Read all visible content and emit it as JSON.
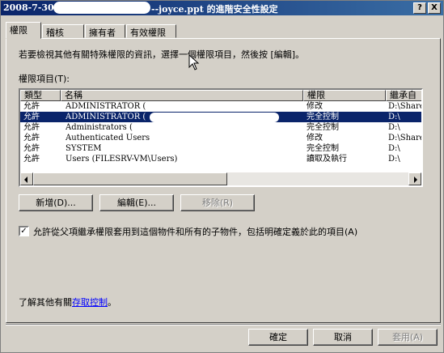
{
  "window": {
    "title_prefix": "2008-7-30",
    "title_suffix": "--joyce.ppt 的進階安全性設定",
    "help_label": "?",
    "close_label": "X"
  },
  "tabs": [
    {
      "label": "權限",
      "active": true
    },
    {
      "label": "稽核",
      "active": false
    },
    {
      "label": "擁有者",
      "active": false
    },
    {
      "label": "有效權限",
      "active": false
    }
  ],
  "description": "若要檢視其他有關特殊權限的資訊，選擇一個權限項目，然後按 [編輯]。",
  "permissions_label": "權限項目(T):",
  "columns": [
    "類型",
    "名稱",
    "權限",
    "繼承自"
  ],
  "entries": [
    {
      "type": "允許",
      "name": "ADMINISTRATOR (",
      "permission": "修改",
      "inherited": "D:\\Share\\",
      "selected": false
    },
    {
      "type": "允許",
      "name": "ADMINISTRATOR (",
      "permission": "完全控制",
      "inherited": "D:\\",
      "selected": true
    },
    {
      "type": "允許",
      "name": "Administrators (",
      "permission": "完全控制",
      "inherited": "D:\\",
      "selected": false
    },
    {
      "type": "允許",
      "name": "Authenticated Users",
      "permission": "修改",
      "inherited": "D:\\Share\\",
      "selected": false
    },
    {
      "type": "允許",
      "name": "SYSTEM",
      "permission": "完全控制",
      "inherited": "D:\\",
      "selected": false
    },
    {
      "type": "允許",
      "name": "Users (FILESRV-VM\\Users)",
      "permission": "讀取及執行",
      "inherited": "D:\\",
      "selected": false
    }
  ],
  "buttons": {
    "add": "新增(D)...",
    "edit": "編輯(E)...",
    "remove": "移除(R)"
  },
  "inherit_checkbox": {
    "checked": true,
    "label": "允許從父項繼承權限套用到這個物件和所有的子物件，包括明確定義於此的項目(A)"
  },
  "info_text": "了解其他有關",
  "info_link": "存取控制",
  "info_end": "。",
  "footer": {
    "ok": "確定",
    "cancel": "取消",
    "apply": "套用(A)"
  }
}
